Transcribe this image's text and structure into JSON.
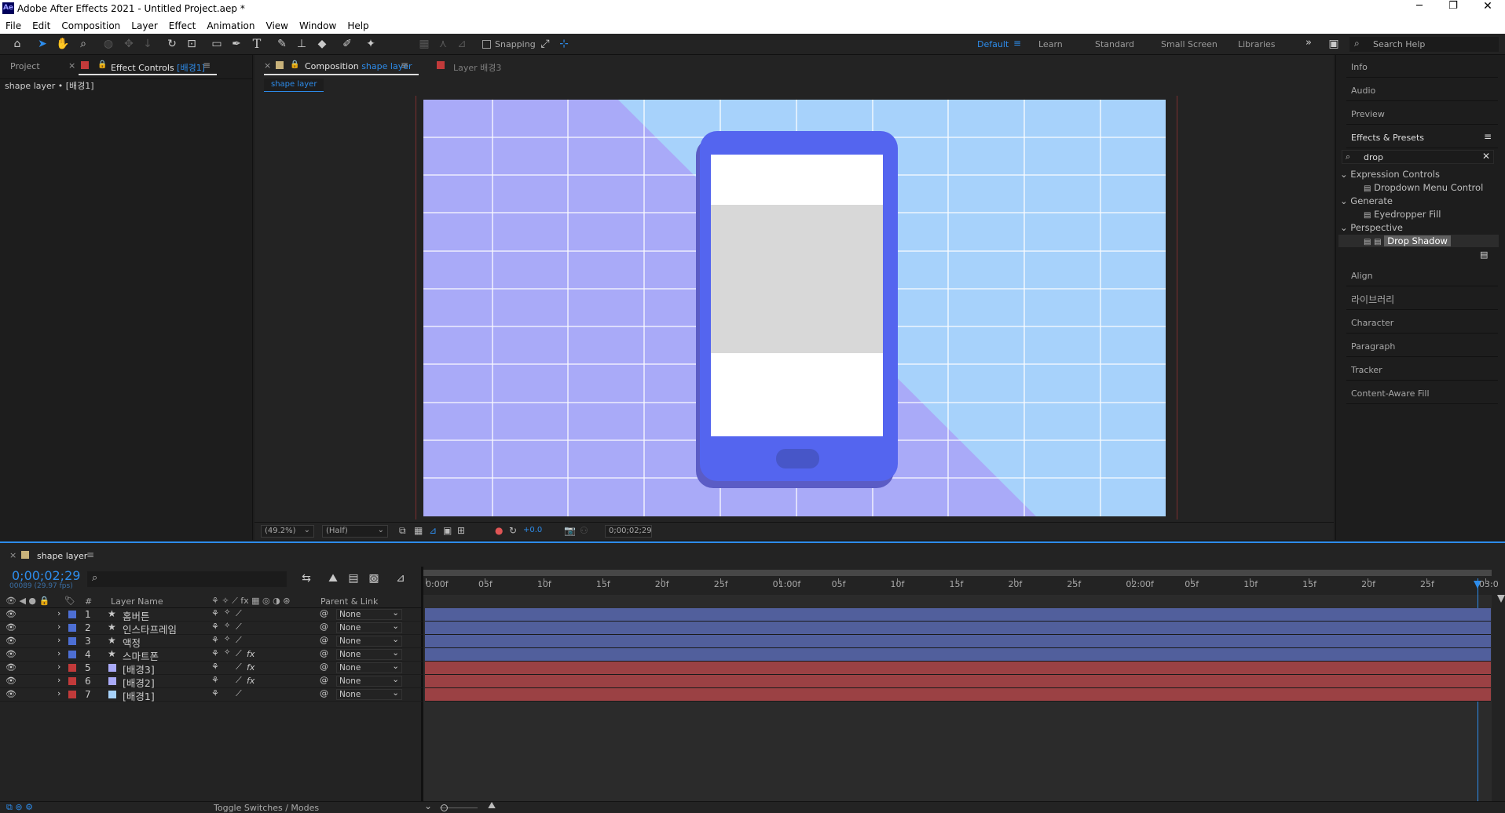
{
  "app": {
    "title": "Adobe After Effects 2021 - Untitled Project.aep *",
    "logo": "Ae"
  },
  "menu": [
    "File",
    "Edit",
    "Composition",
    "Layer",
    "Effect",
    "Animation",
    "View",
    "Window",
    "Help"
  ],
  "toolbar": {
    "snapping": "Snapping",
    "workspaces": [
      "Default",
      "Learn",
      "Standard",
      "Small Screen",
      "Libraries"
    ],
    "search_placeholder": "Search Help"
  },
  "left_panel": {
    "tab_project": "Project",
    "tab_effect_controls": "Effect Controls",
    "effect_target": "[배경1]",
    "subtitle": "shape layer • [배경1]"
  },
  "comp_panel": {
    "tab_prefix": "Composition",
    "tab_name": "shape layer",
    "layer_tab": "Layer  배경3",
    "breadcrumb": "shape layer",
    "zoom": "(49.2%)",
    "resolution": "(Half)",
    "exposure": "+0.0",
    "timecode": "0;00;02;29"
  },
  "right_panel": {
    "info": "Info",
    "audio": "Audio",
    "preview": "Preview",
    "effects_presets": "Effects & Presets",
    "search_value": "drop",
    "tree": [
      {
        "type": "folder",
        "label": "Expression Controls"
      },
      {
        "type": "item",
        "label": "Dropdown Menu Control"
      },
      {
        "type": "folder",
        "label": "Generate"
      },
      {
        "type": "item",
        "label": "Eyedropper Fill"
      },
      {
        "type": "folder",
        "label": "Perspective"
      },
      {
        "type": "item",
        "label": "Drop Shadow",
        "selected": true
      }
    ],
    "align": "Align",
    "library": "라이브러리",
    "character": "Character",
    "paragraph": "Paragraph",
    "tracker": "Tracker",
    "content_aware": "Content-Aware Fill"
  },
  "timeline": {
    "tab": "shape layer",
    "timecode": "0;00;02;29",
    "frame_info": "00089 (29.97 fps)",
    "col_number": "#",
    "col_layer_name": "Layer Name",
    "col_parent": "Parent & Link",
    "ruler": [
      "0:00f",
      "05f",
      "10f",
      "15f",
      "20f",
      "25f",
      "01:00f",
      "05f",
      "10f",
      "15f",
      "20f",
      "25f",
      "02:00f",
      "05f",
      "10f",
      "15f",
      "20f",
      "25f",
      "03:0"
    ],
    "toggle_label": "Toggle Switches / Modes",
    "layers": [
      {
        "num": "1",
        "name": "홈버튼",
        "kind": "shape",
        "label_color": "#4d6fd4",
        "fx": false,
        "parent": "None",
        "bar": "#515f9c"
      },
      {
        "num": "2",
        "name": "인스타프레임",
        "kind": "shape",
        "label_color": "#4d6fd4",
        "fx": false,
        "parent": "None",
        "bar": "#515f9c"
      },
      {
        "num": "3",
        "name": "액정",
        "kind": "shape",
        "label_color": "#4d6fd4",
        "fx": false,
        "parent": "None",
        "bar": "#515f9c"
      },
      {
        "num": "4",
        "name": "스마트폰",
        "kind": "shape",
        "label_color": "#4d6fd4",
        "fx": true,
        "parent": "None",
        "bar": "#515f9c"
      },
      {
        "num": "5",
        "name": "[배경3]",
        "kind": "solid",
        "label_color": "#c23a3a",
        "fx": true,
        "parent": "None",
        "bar": "#9b4144"
      },
      {
        "num": "6",
        "name": "[배경2]",
        "kind": "solid",
        "label_color": "#c23a3a",
        "fx": true,
        "parent": "None",
        "bar": "#9b4144"
      },
      {
        "num": "7",
        "name": "[배경1]",
        "kind": "solid",
        "label_color": "#c23a3a",
        "fx": false,
        "parent": "None",
        "bar": "#9b4144"
      }
    ]
  },
  "colors": {
    "accent": "#2d8ceb",
    "bg_lavender": "#a9aaf8",
    "bg_sky": "#a7d2fb",
    "phone": "#5465ef",
    "phone_shadow": "#5b5cc5",
    "screen_gray": "#d8d8d8"
  }
}
